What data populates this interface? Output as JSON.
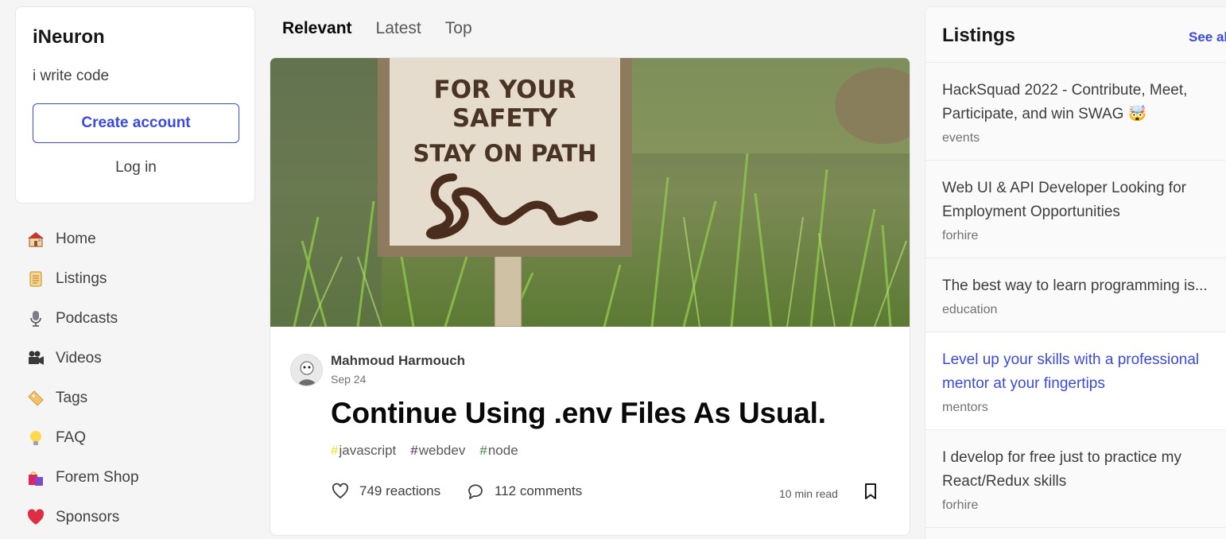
{
  "sidebar": {
    "intro": {
      "title": "iNeuron",
      "subtitle": "i write code",
      "create_account": "Create account",
      "log_in": "Log in"
    },
    "nav": [
      {
        "label": "Home",
        "icon": "house-icon"
      },
      {
        "label": "Listings",
        "icon": "scroll-icon"
      },
      {
        "label": "Podcasts",
        "icon": "microphone-icon"
      },
      {
        "label": "Videos",
        "icon": "movie-camera-icon"
      },
      {
        "label": "Tags",
        "icon": "tag-icon"
      },
      {
        "label": "FAQ",
        "icon": "lightbulb-icon"
      },
      {
        "label": "Forem Shop",
        "icon": "shopping-bags-icon"
      },
      {
        "label": "Sponsors",
        "icon": "heart-icon"
      }
    ]
  },
  "feed": {
    "tabs": [
      {
        "label": "Relevant",
        "active": true
      },
      {
        "label": "Latest",
        "active": false
      },
      {
        "label": "Top",
        "active": false
      }
    ],
    "article": {
      "cover_sign_text": [
        "FOR YOUR",
        "SAFETY",
        "STAY ON PATH"
      ],
      "author": "Mahmoud Harmouch",
      "date": "Sep 24",
      "title": "Continue Using .env Files As Usual.",
      "tags": [
        {
          "name": "javascript",
          "color": "#f7df1e"
        },
        {
          "name": "webdev",
          "color": "#562765"
        },
        {
          "name": "node",
          "color": "#3c873a"
        }
      ],
      "reactions": "749 reactions",
      "comments": "112 comments",
      "read_time": "10 min read"
    }
  },
  "listings": {
    "title": "Listings",
    "see_all": "See all",
    "items": [
      {
        "title": "HackSquad 2022 - Contribute, Meet, Participate, and win SWAG 🤯",
        "category": "events",
        "link": false
      },
      {
        "title": "Web UI & API Developer Looking for Employment Opportunities",
        "category": "forhire",
        "link": false
      },
      {
        "title": "The best way to learn programming is...",
        "category": "education",
        "link": false
      },
      {
        "title": "Level up your skills with a professional mentor at your fingertips",
        "category": "mentors",
        "link": true
      },
      {
        "title": "I develop for free just to practice my React/Redux skills",
        "category": "forhire",
        "link": false
      }
    ]
  },
  "colors": {
    "accent": "#3b49df",
    "background": "#f5f5f5"
  }
}
